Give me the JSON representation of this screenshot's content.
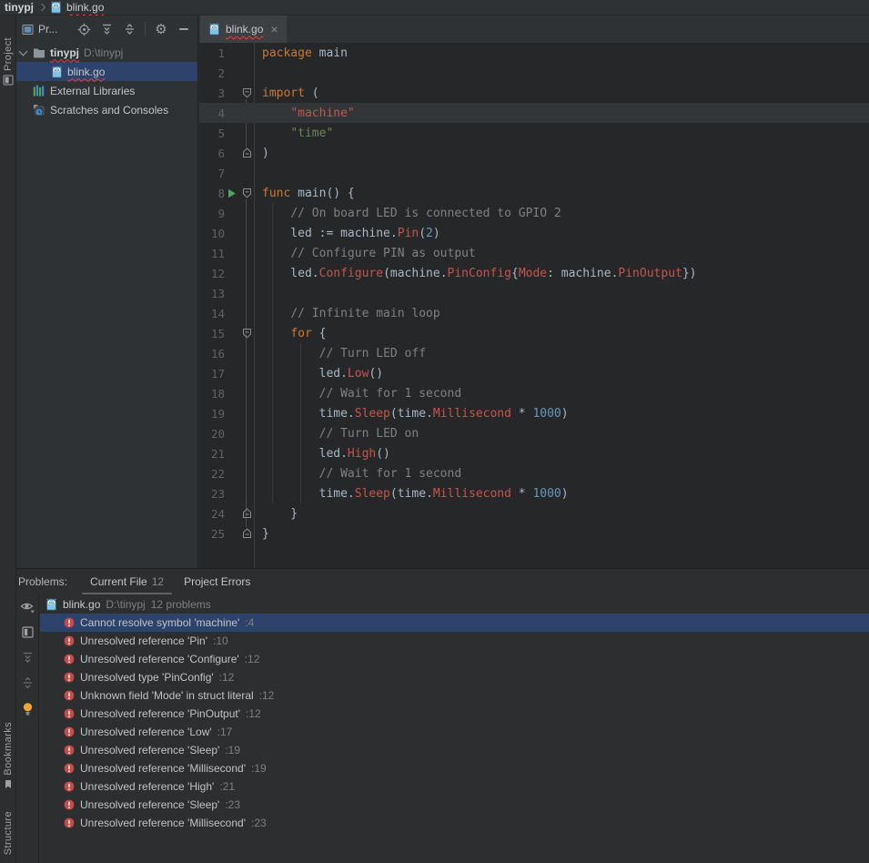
{
  "breadcrumb": {
    "project": "tinypj",
    "file": "blink.go"
  },
  "stripe": {
    "project": "Project",
    "bookmarks": "Bookmarks",
    "structure": "Structure"
  },
  "project_panel": {
    "title": "Pr...",
    "tree": [
      {
        "label": "tinypj",
        "detail": "D:\\tinypj",
        "icon": "folder",
        "bold": true,
        "squiggle": true,
        "chevron": true,
        "indent": 0,
        "selected": false
      },
      {
        "label": "blink.go",
        "detail": "",
        "icon": "gopher",
        "bold": false,
        "squiggle": true,
        "chevron": false,
        "indent": 1,
        "selected": true
      },
      {
        "label": "External Libraries",
        "detail": "",
        "icon": "library",
        "bold": false,
        "squiggle": false,
        "chevron": false,
        "indent": 0,
        "selected": false
      },
      {
        "label": "Scratches and Consoles",
        "detail": "",
        "icon": "scratches",
        "bold": false,
        "squiggle": false,
        "chevron": false,
        "indent": 0,
        "selected": false
      }
    ]
  },
  "editor": {
    "tab": {
      "title": "blink.go"
    },
    "lines": [
      {
        "n": 1,
        "segs": [
          [
            "k",
            "package"
          ],
          [
            "p",
            " main"
          ]
        ]
      },
      {
        "n": 2,
        "segs": []
      },
      {
        "n": 3,
        "fold": "start",
        "segs": [
          [
            "k",
            "import"
          ],
          [
            "p",
            " ("
          ]
        ]
      },
      {
        "n": 4,
        "cur": true,
        "segs": [
          [
            "p",
            "    "
          ],
          [
            "e",
            "\"machine\""
          ]
        ]
      },
      {
        "n": 5,
        "segs": [
          [
            "p",
            "    "
          ],
          [
            "s",
            "\"time\""
          ]
        ]
      },
      {
        "n": 6,
        "fold": "end",
        "segs": [
          [
            "p",
            ")"
          ]
        ]
      },
      {
        "n": 7,
        "segs": []
      },
      {
        "n": 8,
        "fold": "start",
        "run": true,
        "segs": [
          [
            "k",
            "func"
          ],
          [
            "p",
            " main() {"
          ]
        ]
      },
      {
        "n": 9,
        "segs": [
          [
            "p",
            "    "
          ],
          [
            "c",
            "// On board LED is connected to GPIO 2"
          ]
        ]
      },
      {
        "n": 10,
        "segs": [
          [
            "p",
            "    led := machine."
          ],
          [
            "e",
            "Pin"
          ],
          [
            "p",
            "("
          ],
          [
            "n2",
            "2"
          ],
          [
            "p",
            ")"
          ]
        ]
      },
      {
        "n": 11,
        "segs": [
          [
            "p",
            "    "
          ],
          [
            "c",
            "// Configure PIN as output"
          ]
        ]
      },
      {
        "n": 12,
        "segs": [
          [
            "p",
            "    led."
          ],
          [
            "e",
            "Configure"
          ],
          [
            "p",
            "(machine."
          ],
          [
            "e",
            "PinConfig"
          ],
          [
            "p",
            "{"
          ],
          [
            "e",
            "Mode"
          ],
          [
            "p",
            ": machine."
          ],
          [
            "e",
            "PinOutput"
          ],
          [
            "p",
            "})"
          ]
        ]
      },
      {
        "n": 13,
        "segs": []
      },
      {
        "n": 14,
        "segs": [
          [
            "p",
            "    "
          ],
          [
            "c",
            "// Infinite main loop"
          ]
        ]
      },
      {
        "n": 15,
        "fold": "start",
        "segs": [
          [
            "p",
            "    "
          ],
          [
            "k",
            "for"
          ],
          [
            "p",
            " {"
          ]
        ]
      },
      {
        "n": 16,
        "segs": [
          [
            "p",
            "        "
          ],
          [
            "c",
            "// Turn LED off"
          ]
        ]
      },
      {
        "n": 17,
        "segs": [
          [
            "p",
            "        led."
          ],
          [
            "e",
            "Low"
          ],
          [
            "p",
            "()"
          ]
        ]
      },
      {
        "n": 18,
        "segs": [
          [
            "p",
            "        "
          ],
          [
            "c",
            "// Wait for 1 second"
          ]
        ]
      },
      {
        "n": 19,
        "segs": [
          [
            "p",
            "        time."
          ],
          [
            "e",
            "Sleep"
          ],
          [
            "p",
            "(time."
          ],
          [
            "e",
            "Millisecond"
          ],
          [
            "p",
            " * "
          ],
          [
            "n2",
            "1000"
          ],
          [
            "p",
            ")"
          ]
        ]
      },
      {
        "n": 20,
        "segs": [
          [
            "p",
            "        "
          ],
          [
            "c",
            "// Turn LED on"
          ]
        ]
      },
      {
        "n": 21,
        "segs": [
          [
            "p",
            "        led."
          ],
          [
            "e",
            "High"
          ],
          [
            "p",
            "()"
          ]
        ]
      },
      {
        "n": 22,
        "segs": [
          [
            "p",
            "        "
          ],
          [
            "c",
            "// Wait for 1 second"
          ]
        ]
      },
      {
        "n": 23,
        "segs": [
          [
            "p",
            "        time."
          ],
          [
            "e",
            "Sleep"
          ],
          [
            "p",
            "(time."
          ],
          [
            "e",
            "Millisecond"
          ],
          [
            "p",
            " * "
          ],
          [
            "n2",
            "1000"
          ],
          [
            "p",
            ")"
          ]
        ]
      },
      {
        "n": 24,
        "fold": "end",
        "segs": [
          [
            "p",
            "    }"
          ]
        ]
      },
      {
        "n": 25,
        "fold": "end",
        "segs": [
          [
            "p",
            "}"
          ]
        ]
      }
    ]
  },
  "problems": {
    "label": "Problems:",
    "tabs": [
      {
        "label": "Current File",
        "count": "12",
        "selected": true
      },
      {
        "label": "Project Errors",
        "count": "",
        "selected": false
      }
    ],
    "file": {
      "name": "blink.go",
      "path": "D:\\tinypj",
      "summary": "12 problems"
    },
    "items": [
      {
        "text": "Cannot resolve symbol 'machine'",
        "loc": ":4",
        "selected": true
      },
      {
        "text": "Unresolved reference 'Pin'",
        "loc": ":10",
        "selected": false
      },
      {
        "text": "Unresolved reference 'Configure'",
        "loc": ":12",
        "selected": false
      },
      {
        "text": "Unresolved type 'PinConfig'",
        "loc": ":12",
        "selected": false
      },
      {
        "text": "Unknown field 'Mode' in struct literal",
        "loc": ":12",
        "selected": false
      },
      {
        "text": "Unresolved reference 'PinOutput'",
        "loc": ":12",
        "selected": false
      },
      {
        "text": "Unresolved reference 'Low'",
        "loc": ":17",
        "selected": false
      },
      {
        "text": "Unresolved reference 'Sleep'",
        "loc": ":19",
        "selected": false
      },
      {
        "text": "Unresolved reference 'Millisecond'",
        "loc": ":19",
        "selected": false
      },
      {
        "text": "Unresolved reference 'High'",
        "loc": ":21",
        "selected": false
      },
      {
        "text": "Unresolved reference 'Sleep'",
        "loc": ":23",
        "selected": false
      },
      {
        "text": "Unresolved reference 'Millisecond'",
        "loc": ":23",
        "selected": false
      }
    ]
  },
  "colors": {
    "selection": "#2d436b",
    "error_red": "#c94a4a",
    "squiggle": "#e8413c",
    "run_green": "#4fa55b",
    "lightbulb": "#eda738",
    "syntax": {
      "keyword": "#cc7832",
      "string": "#6a8759",
      "error": "#c75450",
      "comment": "#808080",
      "number": "#6897bb",
      "plain": "#a9b7c6"
    }
  }
}
